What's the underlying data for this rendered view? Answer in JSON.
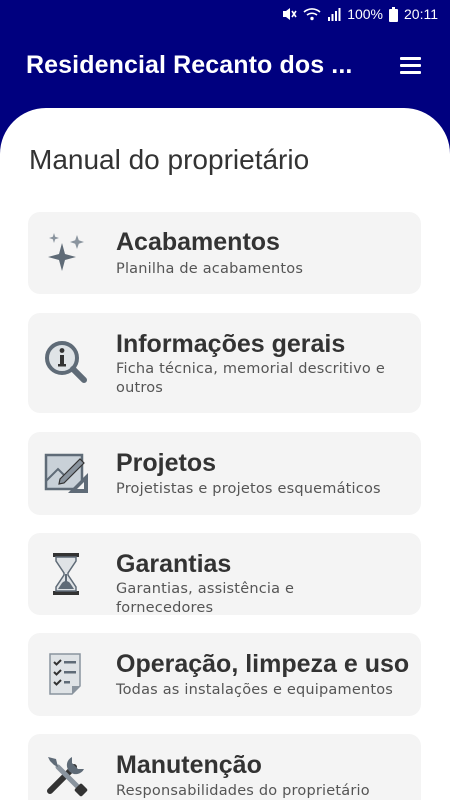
{
  "status": {
    "battery": "100%",
    "time": "20:11",
    "icons": [
      "mute-icon",
      "wifi-icon",
      "signal-icon",
      "battery-icon"
    ]
  },
  "appbar": {
    "title": "Residencial Recanto dos ...",
    "menu_icon": "hamburger-menu-icon"
  },
  "page": {
    "title": "Manual do proprietário"
  },
  "cards": [
    {
      "icon": "sparkles-icon",
      "title": "Acabamentos",
      "subtitle": "Planilha de acabamentos"
    },
    {
      "icon": "info-magnifier-icon",
      "title": "Informações gerais",
      "subtitle": "Ficha técnica, memorial descritivo e outros"
    },
    {
      "icon": "blueprint-icon",
      "title": "Projetos",
      "subtitle": "Projetistas e projetos esquemáticos"
    },
    {
      "icon": "hourglass-icon",
      "title": "Garantias",
      "subtitle": "Garantias, assistência e fornecedores"
    },
    {
      "icon": "checklist-icon",
      "title": "Operação, limpeza e uso",
      "subtitle": "Todas as instalações e equipamentos"
    },
    {
      "icon": "tools-icon",
      "title": "Manutenção",
      "subtitle": "Responsabilidades do proprietário"
    }
  ]
}
